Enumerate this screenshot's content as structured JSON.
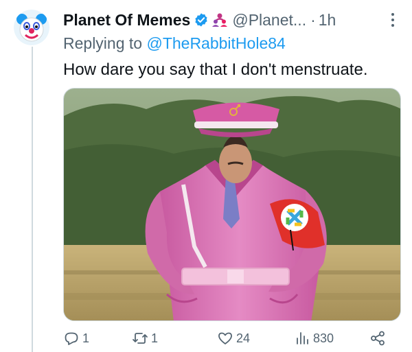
{
  "tweet": {
    "author": {
      "display_name": "Planet Of Memes",
      "handle": "@Planet...",
      "avatar_icon": "clown-face-icon",
      "verified_icon": "verified-badge-icon",
      "affiliate_icon": "affiliate-people-icon"
    },
    "separator": "·",
    "time": "1h",
    "replying_prefix": "Replying to ",
    "replying_to": "@TheRabbitHole84",
    "text": "How dare you say that I don't menstruate.",
    "media": {
      "type": "meme-photo",
      "subject": "man in pink military uniform with armband"
    },
    "actions": {
      "reply": {
        "icon": "reply-icon",
        "count": "1"
      },
      "retweet": {
        "icon": "retweet-icon",
        "count": "1"
      },
      "like": {
        "icon": "heart-icon",
        "count": "24"
      },
      "views": {
        "icon": "views-chart-icon",
        "count": "830"
      },
      "share": {
        "icon": "share-icon"
      }
    }
  },
  "colors": {
    "text": "#0f1419",
    "secondary": "#536471",
    "link": "#1d9bf0",
    "verified": "#1d9bf0",
    "affiliate": "#c13584",
    "thread_line": "#cfd9de"
  }
}
